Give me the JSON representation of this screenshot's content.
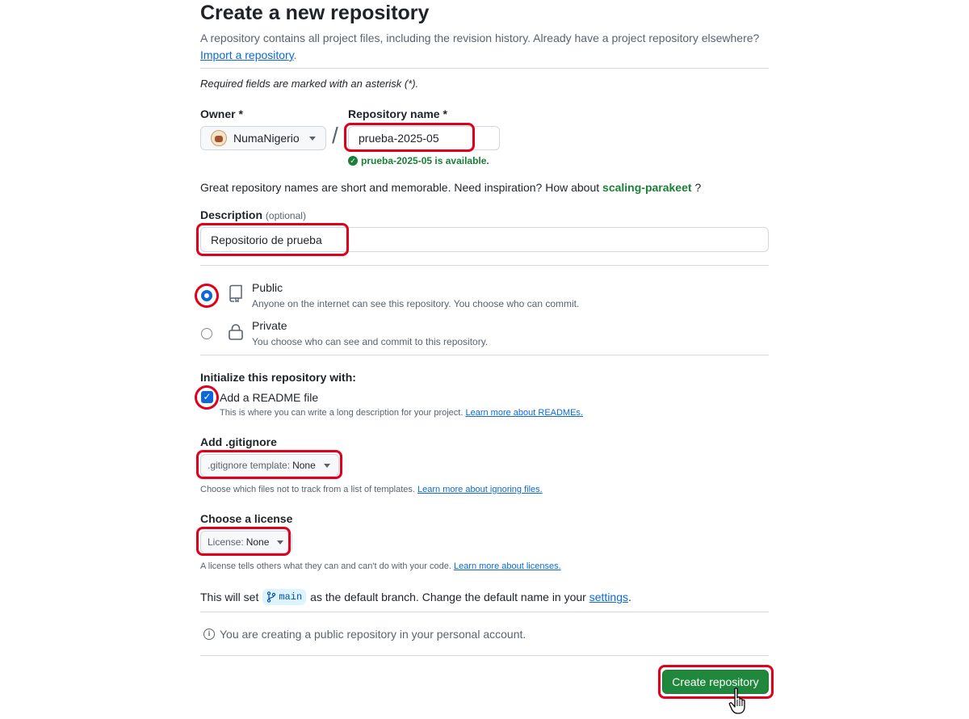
{
  "page": {
    "title": "Create a new repository",
    "intro": "A repository contains all project files, including the revision history. Already have a project repository elsewhere?",
    "import_link": "Import a repository",
    "required_note": "Required fields are marked with an asterisk (*)."
  },
  "owner": {
    "label": "Owner *",
    "value": "NumaNigerio"
  },
  "repo_name": {
    "label": "Repository name *",
    "value": "prueba-2025-05",
    "availability": "prueba-2025-05 is available."
  },
  "suggestion": {
    "text": "Great repository names are short and memorable. Need inspiration? How about",
    "name": "scaling-parakeet",
    "suffix": "?"
  },
  "description": {
    "label": "Description",
    "optional": "(optional)",
    "value": "Repositorio de prueba"
  },
  "visibility": {
    "selected": "public",
    "public": {
      "title": "Public",
      "subtitle": "Anyone on the internet can see this repository. You choose who can commit."
    },
    "private": {
      "title": "Private",
      "subtitle": "You choose who can see and commit to this repository."
    }
  },
  "initialize": {
    "heading": "Initialize this repository with:",
    "readme_label": "Add a README file",
    "readme_checked": true,
    "readme_help": "This is where you can write a long description for your project.",
    "readme_link": "Learn more about READMEs."
  },
  "gitignore": {
    "heading": "Add .gitignore",
    "button_prefix": ".gitignore template:",
    "button_value": "None",
    "help": "Choose which files not to track from a list of templates.",
    "link": "Learn more about ignoring files."
  },
  "license": {
    "heading": "Choose a license",
    "button_prefix": "License:",
    "button_value": "None",
    "help": "A license tells others what they can and can't do with your code.",
    "link": "Learn more about licenses."
  },
  "branch": {
    "prefix": "This will set",
    "name": "main",
    "middle": "as the default branch. Change the default name in your",
    "settings_link": "settings",
    "suffix": "."
  },
  "info": {
    "text": "You are creating a public repository in your personal account."
  },
  "actions": {
    "create_label": "Create repository"
  },
  "colors": {
    "primary_green": "#1f883d",
    "link_blue": "#0969da",
    "highlight_red": "#e0001b",
    "success_green": "#1a7f37"
  }
}
